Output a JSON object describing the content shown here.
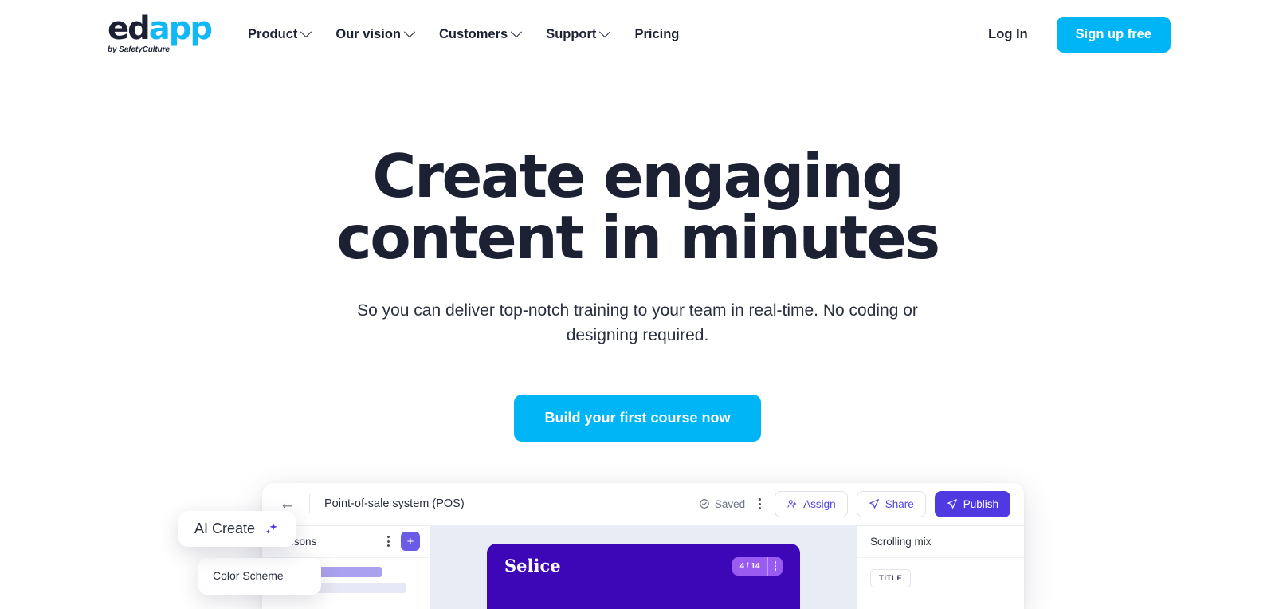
{
  "header": {
    "logo": {
      "part1": "ed",
      "part2": "app",
      "byline_prefix": "by ",
      "byline_brand": "SafetyCulture"
    },
    "nav": [
      {
        "label": "Product",
        "has_chevron": true
      },
      {
        "label": "Our vision",
        "has_chevron": true
      },
      {
        "label": "Customers",
        "has_chevron": true
      },
      {
        "label": "Support",
        "has_chevron": true
      },
      {
        "label": "Pricing",
        "has_chevron": false
      }
    ],
    "login_label": "Log In",
    "signup_label": "Sign up free"
  },
  "hero": {
    "title_line1": "Create engaging",
    "title_line2": "content in minutes",
    "subtitle": "So you can deliver top-notch training to your team in real-time. No coding or designing required.",
    "cta_label": "Build your first course now"
  },
  "mockup": {
    "topbar": {
      "back_icon": "arrow-left-icon",
      "title": "Point-of-sale system (POS)",
      "saved_label": "Saved",
      "saved_icon": "check-circle-icon",
      "menu_icon": "kebab-menu-icon",
      "assign_label": "Assign",
      "share_label": "Share",
      "publish_label": "Publish"
    },
    "sidebar_left": {
      "lessons_label": "Lessons",
      "menu_icon": "kebab-menu-icon",
      "add_label": "+"
    },
    "canvas": {
      "slide_title": "Selice",
      "pager": "4 / 14",
      "pager_menu_icon": "kebab-menu-icon"
    },
    "sidebar_right": {
      "panel_title": "Scrolling mix",
      "block_chip": "TITLE"
    },
    "floating": {
      "ai_create_label": "AI Create",
      "ai_create_icon": "sparkle-icon",
      "color_scheme_label": "Color Scheme"
    }
  },
  "colors": {
    "brand_cyan": "#00b5f5",
    "logo_cyan": "#12b7f5",
    "ink": "#1b2133",
    "purple_primary": "#4f39e0",
    "purple_accent": "#6b5ce7",
    "slide_purple": "#3d07b8",
    "pager_purple": "#9a5cf0",
    "canvas_bg": "#e8ecf4"
  }
}
